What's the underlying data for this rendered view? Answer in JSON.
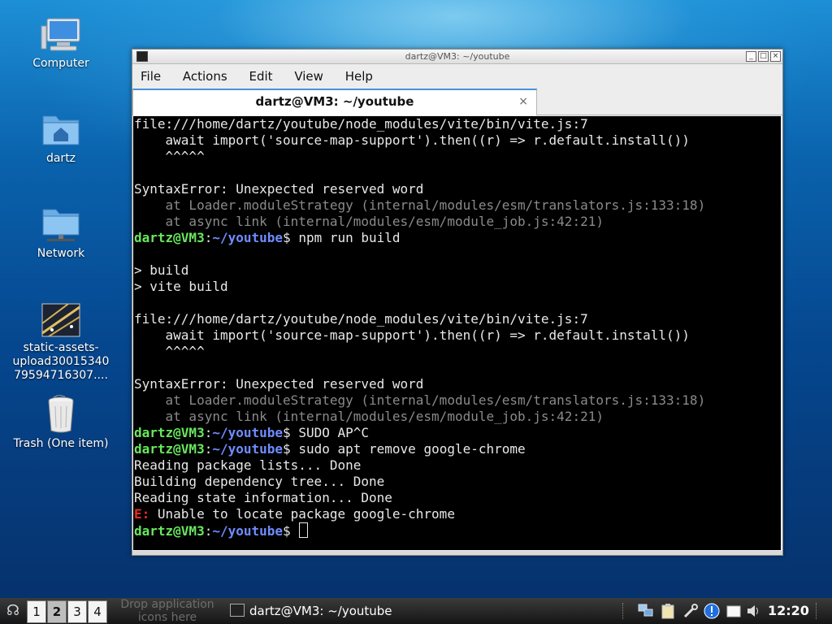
{
  "desktop": {
    "icons": [
      {
        "label": "Computer"
      },
      {
        "label": "dartz"
      },
      {
        "label": "Network"
      },
      {
        "label": "static-assets-\nupload30015340\n79594716307...."
      },
      {
        "label": "Trash (One item)"
      }
    ]
  },
  "window": {
    "title": "dartz@VM3: ~/youtube",
    "menu": [
      "File",
      "Actions",
      "Edit",
      "View",
      "Help"
    ],
    "tab_label": "dartz@VM3: ~/youtube",
    "tab_close": "×"
  },
  "terminal": {
    "prompt_user": "dartz@VM3",
    "prompt_path": "~/youtube",
    "lines": [
      {
        "type": "text",
        "text": "file:///home/dartz/youtube/node_modules/vite/bin/vite.js:7"
      },
      {
        "type": "text",
        "text": "    await import('source-map-support').then((r) => r.default.install())"
      },
      {
        "type": "text",
        "text": "    ^^^^^"
      },
      {
        "type": "text",
        "text": ""
      },
      {
        "type": "text",
        "text": "SyntaxError: Unexpected reserved word"
      },
      {
        "type": "dim",
        "text": "    at Loader.moduleStrategy (internal/modules/esm/translators.js:133:18)"
      },
      {
        "type": "dim",
        "text": "    at async link (internal/modules/esm/module_job.js:42:21)"
      },
      {
        "type": "prompt",
        "cmd": " npm run build"
      },
      {
        "type": "text",
        "text": ""
      },
      {
        "type": "text",
        "text": "> build"
      },
      {
        "type": "text",
        "text": "> vite build"
      },
      {
        "type": "text",
        "text": ""
      },
      {
        "type": "text",
        "text": "file:///home/dartz/youtube/node_modules/vite/bin/vite.js:7"
      },
      {
        "type": "text",
        "text": "    await import('source-map-support').then((r) => r.default.install())"
      },
      {
        "type": "text",
        "text": "    ^^^^^"
      },
      {
        "type": "text",
        "text": ""
      },
      {
        "type": "text",
        "text": "SyntaxError: Unexpected reserved word"
      },
      {
        "type": "dim",
        "text": "    at Loader.moduleStrategy (internal/modules/esm/translators.js:133:18)"
      },
      {
        "type": "dim",
        "text": "    at async link (internal/modules/esm/module_job.js:42:21)"
      },
      {
        "type": "prompt",
        "cmd": " SUDO AP^C"
      },
      {
        "type": "prompt",
        "cmd": " sudo apt remove google-chrome"
      },
      {
        "type": "text",
        "text": "Reading package lists... Done"
      },
      {
        "type": "text",
        "text": "Building dependency tree... Done"
      },
      {
        "type": "text",
        "text": "Reading state information... Done"
      },
      {
        "type": "error",
        "prefix": "E:",
        "text": " Unable to locate package google-chrome"
      },
      {
        "type": "prompt",
        "cmd": " ",
        "cursor": true
      }
    ]
  },
  "taskbar": {
    "workspaces": [
      "1",
      "2",
      "3",
      "4"
    ],
    "active_workspace": "2",
    "drop_text": "Drop application icons here",
    "task_label": "dartz@VM3: ~/youtube",
    "clock": "12:20",
    "tray_icons": [
      "network-icon",
      "clipboard-icon",
      "tools-icon",
      "update-alert-icon",
      "notes-icon",
      "volume-icon"
    ]
  }
}
